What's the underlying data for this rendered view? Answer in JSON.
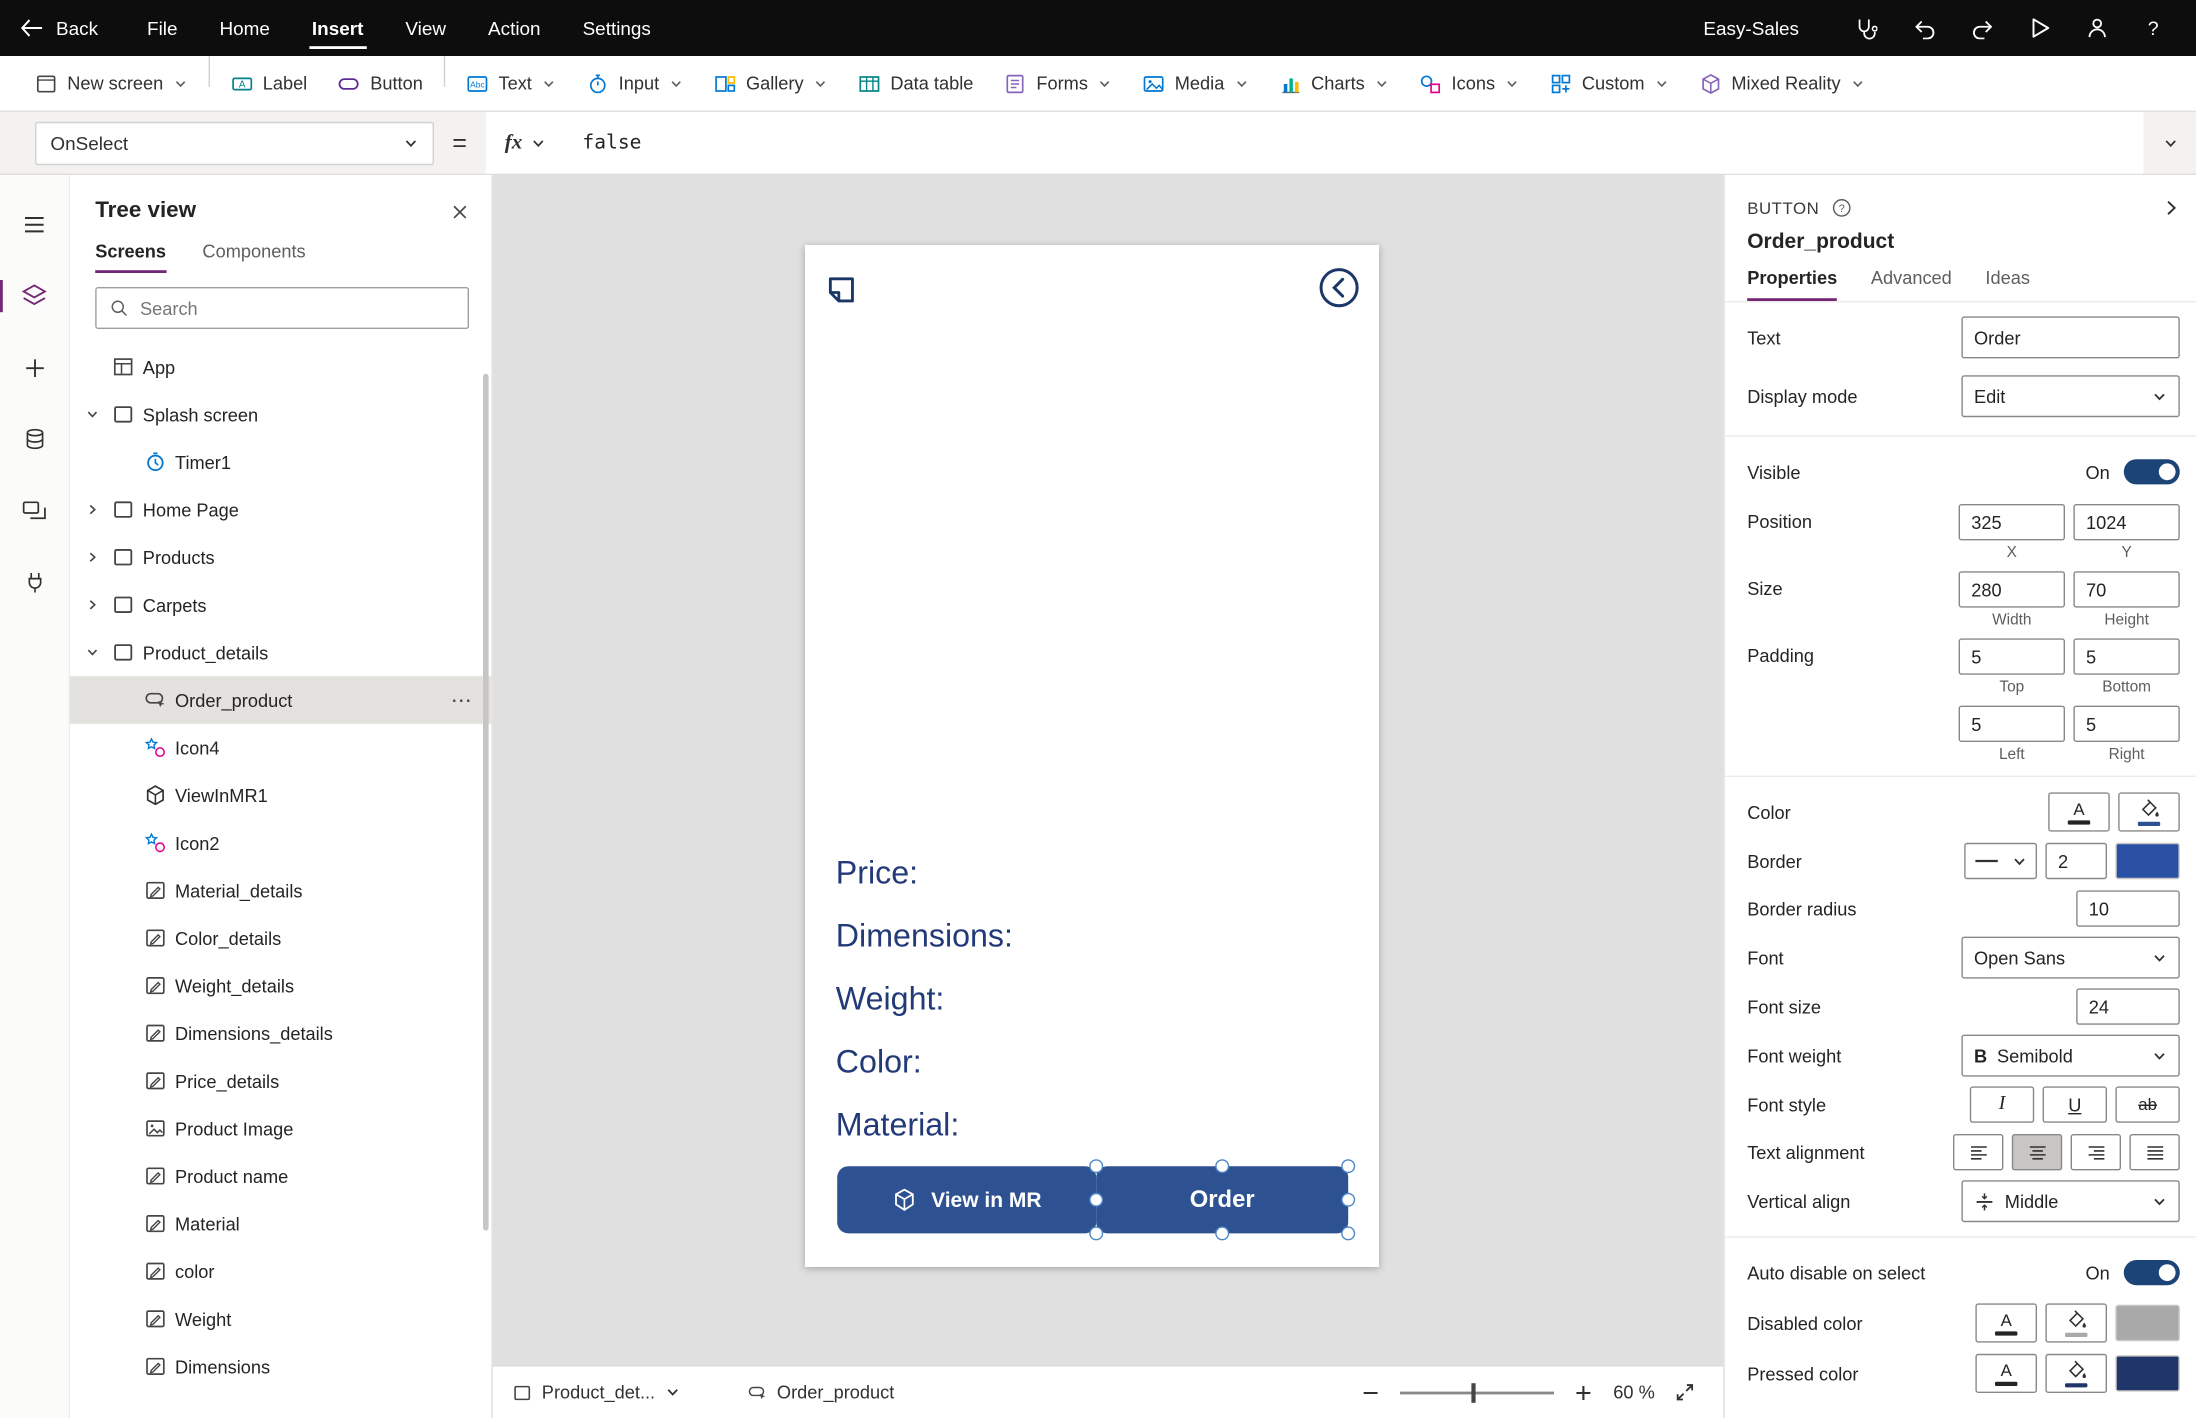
{
  "topbar": {
    "back_label": "Back",
    "menus": [
      "File",
      "Home",
      "Insert",
      "View",
      "Action",
      "Settings"
    ],
    "active_menu": "Insert",
    "app_name": "Easy-Sales"
  },
  "ribbon": {
    "items": [
      {
        "label": "New screen",
        "icon": "new-screen",
        "dropdown": true,
        "divider_after": true
      },
      {
        "label": "Label",
        "icon": "label",
        "dropdown": false
      },
      {
        "label": "Button",
        "icon": "button",
        "dropdown": false,
        "divider_after": true
      },
      {
        "label": "Text",
        "icon": "text",
        "dropdown": true
      },
      {
        "label": "Input",
        "icon": "input",
        "dropdown": true
      },
      {
        "label": "Gallery",
        "icon": "gallery",
        "dropdown": true
      },
      {
        "label": "Data table",
        "icon": "datatable",
        "dropdown": false
      },
      {
        "label": "Forms",
        "icon": "forms",
        "dropdown": true
      },
      {
        "label": "Media",
        "icon": "media",
        "dropdown": true
      },
      {
        "label": "Charts",
        "icon": "charts",
        "dropdown": true
      },
      {
        "label": "Icons",
        "icon": "icons",
        "dropdown": true
      },
      {
        "label": "Custom",
        "icon": "custom",
        "dropdown": true
      },
      {
        "label": "Mixed Reality",
        "icon": "mr",
        "dropdown": true
      }
    ]
  },
  "formula_bar": {
    "property": "OnSelect",
    "equals": "=",
    "fx_label": "fx",
    "value": "false"
  },
  "tree_panel": {
    "title": "Tree view",
    "tabs": [
      "Screens",
      "Components"
    ],
    "active_tab": "Screens",
    "search_placeholder": "Search",
    "items": [
      {
        "label": "App",
        "icon": "app",
        "depth": 0
      },
      {
        "label": "Splash screen",
        "icon": "screen",
        "depth": 0,
        "expand": "open"
      },
      {
        "label": "Timer1",
        "icon": "timer",
        "depth": 1
      },
      {
        "label": "Home Page",
        "icon": "screen",
        "depth": 0,
        "expand": "closed"
      },
      {
        "label": "Products",
        "icon": "screen",
        "depth": 0,
        "expand": "closed"
      },
      {
        "label": "Carpets",
        "icon": "screen",
        "depth": 0,
        "expand": "closed"
      },
      {
        "label": "Product_details",
        "icon": "screen",
        "depth": 0,
        "expand": "open"
      },
      {
        "label": "Order_product",
        "icon": "button-ctrl",
        "depth": 1,
        "selected": true,
        "menu": true
      },
      {
        "label": "Icon4",
        "icon": "icons-ctrl",
        "depth": 1
      },
      {
        "label": "ViewInMR1",
        "icon": "mr-ctrl",
        "depth": 1
      },
      {
        "label": "Icon2",
        "icon": "icons-ctrl",
        "depth": 1
      },
      {
        "label": "Material_details",
        "icon": "label-ctrl",
        "depth": 1
      },
      {
        "label": "Color_details",
        "icon": "label-ctrl",
        "depth": 1
      },
      {
        "label": "Weight_details",
        "icon": "label-ctrl",
        "depth": 1
      },
      {
        "label": "Dimensions_details",
        "icon": "label-ctrl",
        "depth": 1
      },
      {
        "label": "Price_details",
        "icon": "label-ctrl",
        "depth": 1
      },
      {
        "label": "Product Image",
        "icon": "image",
        "depth": 1
      },
      {
        "label": "Product name",
        "icon": "label-ctrl",
        "depth": 1
      },
      {
        "label": "Material",
        "icon": "label-ctrl",
        "depth": 1
      },
      {
        "label": "color",
        "icon": "label-ctrl",
        "depth": 1
      },
      {
        "label": "Weight",
        "icon": "label-ctrl",
        "depth": 1
      },
      {
        "label": "Dimensions",
        "icon": "label-ctrl",
        "depth": 1
      }
    ]
  },
  "canvas": {
    "labels": [
      "Price:",
      "Dimensions:",
      "Weight:",
      "Color:",
      "Material:"
    ],
    "view_in_mr_label": "View in MR",
    "order_label": "Order",
    "button_color": "#2e5291",
    "text_color": "#233a78"
  },
  "status_bar": {
    "screen_selector": "Product_det...",
    "selected_control": "Order_product",
    "zoom_value": "60",
    "zoom_unit": "%"
  },
  "properties_panel": {
    "control_type": "BUTTON",
    "control_name": "Order_product",
    "tabs": [
      "Properties",
      "Advanced",
      "Ideas"
    ],
    "active_tab": "Properties",
    "glyphs": {
      "font_color": "A",
      "bold": "B",
      "italic": "I",
      "underline": "U",
      "strikethrough": "ab"
    },
    "rows": {
      "text": {
        "label": "Text",
        "value": "Order"
      },
      "display_mode": {
        "label": "Display mode",
        "value": "Edit"
      },
      "visible": {
        "label": "Visible",
        "state": "On"
      },
      "position": {
        "label": "Position",
        "x": "325",
        "y": "1024",
        "x_label": "X",
        "y_label": "Y"
      },
      "size": {
        "label": "Size",
        "width": "280",
        "height": "70",
        "width_label": "Width",
        "height_label": "Height"
      },
      "padding": {
        "label": "Padding",
        "top": "5",
        "bottom": "5",
        "left": "5",
        "right": "5",
        "top_label": "Top",
        "bottom_label": "Bottom",
        "left_label": "Left",
        "right_label": "Right"
      },
      "color": {
        "label": "Color"
      },
      "border": {
        "label": "Border",
        "weight": "2",
        "color": "#2a50a4"
      },
      "border_radius": {
        "label": "Border radius",
        "value": "10"
      },
      "font": {
        "label": "Font",
        "value": "Open Sans"
      },
      "font_size": {
        "label": "Font size",
        "value": "24"
      },
      "font_weight": {
        "label": "Font weight",
        "value": "Semibold"
      },
      "font_style": {
        "label": "Font style"
      },
      "text_alignment": {
        "label": "Text alignment"
      },
      "vertical_align": {
        "label": "Vertical align",
        "value": "Middle"
      },
      "auto_disable": {
        "label": "Auto disable on select",
        "state": "On"
      },
      "disabled_color": {
        "label": "Disabled color",
        "swatch": "#a9a9a9"
      },
      "pressed_color": {
        "label": "Pressed color",
        "swatch": "#20366b"
      }
    }
  },
  "colors": {
    "accent_purple": "#742774",
    "topbar_background": "#0d0d0e",
    "toggle_on": "#1c4476",
    "selection_handle": "#4f86c6"
  }
}
